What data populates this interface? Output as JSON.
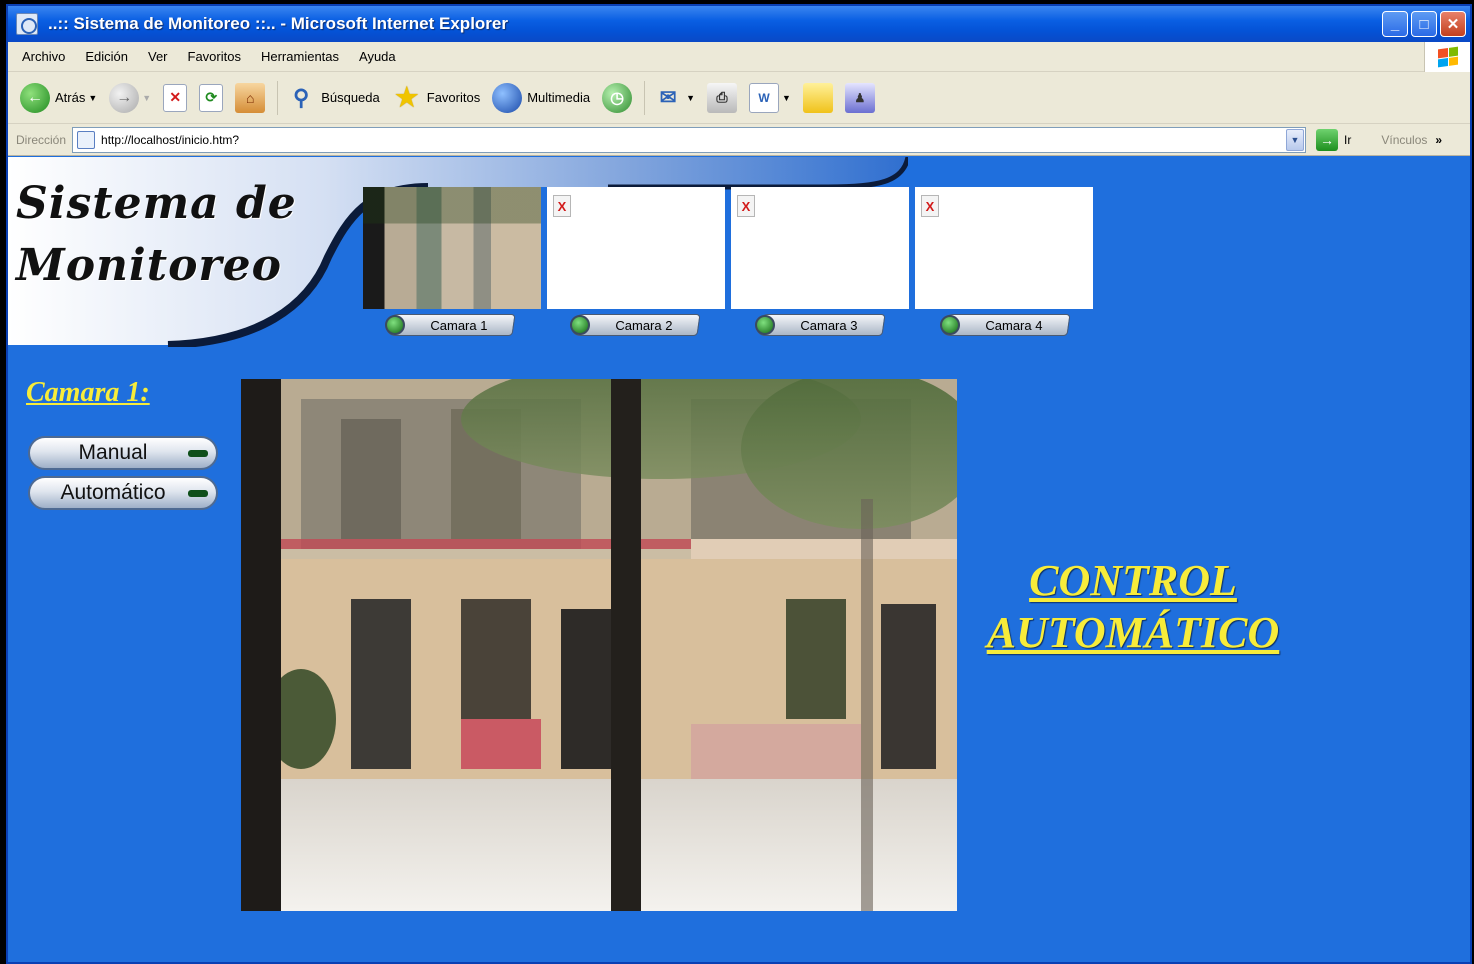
{
  "window": {
    "title": "..:: Sistema de Monitoreo ::.. - Microsoft Internet Explorer"
  },
  "menu": [
    "Archivo",
    "Edición",
    "Ver",
    "Favoritos",
    "Herramientas",
    "Ayuda"
  ],
  "toolbar": {
    "back": "Atrás",
    "search": "Búsqueda",
    "favorites": "Favoritos",
    "multimedia": "Multimedia"
  },
  "address": {
    "label": "Dirección",
    "url": "http://localhost/inicio.htm?",
    "go": "Ir",
    "links": "Vínculos"
  },
  "page": {
    "logo_line1": "Sistema de",
    "logo_line2": "Monitoreo",
    "camera_buttons": [
      "Camara 1",
      "Camara 2",
      "Camara 3",
      "Camara 4"
    ],
    "broken_image_mark": "X",
    "camera_heading": "Camara 1:",
    "mode_manual": "Manual",
    "mode_auto": "Automático",
    "control_line1": "CONTROL",
    "control_line2": "AUTOMÁTICO"
  },
  "colors": {
    "page_background": "#1f6fdd",
    "heading_yellow": "#f7ec3a"
  }
}
